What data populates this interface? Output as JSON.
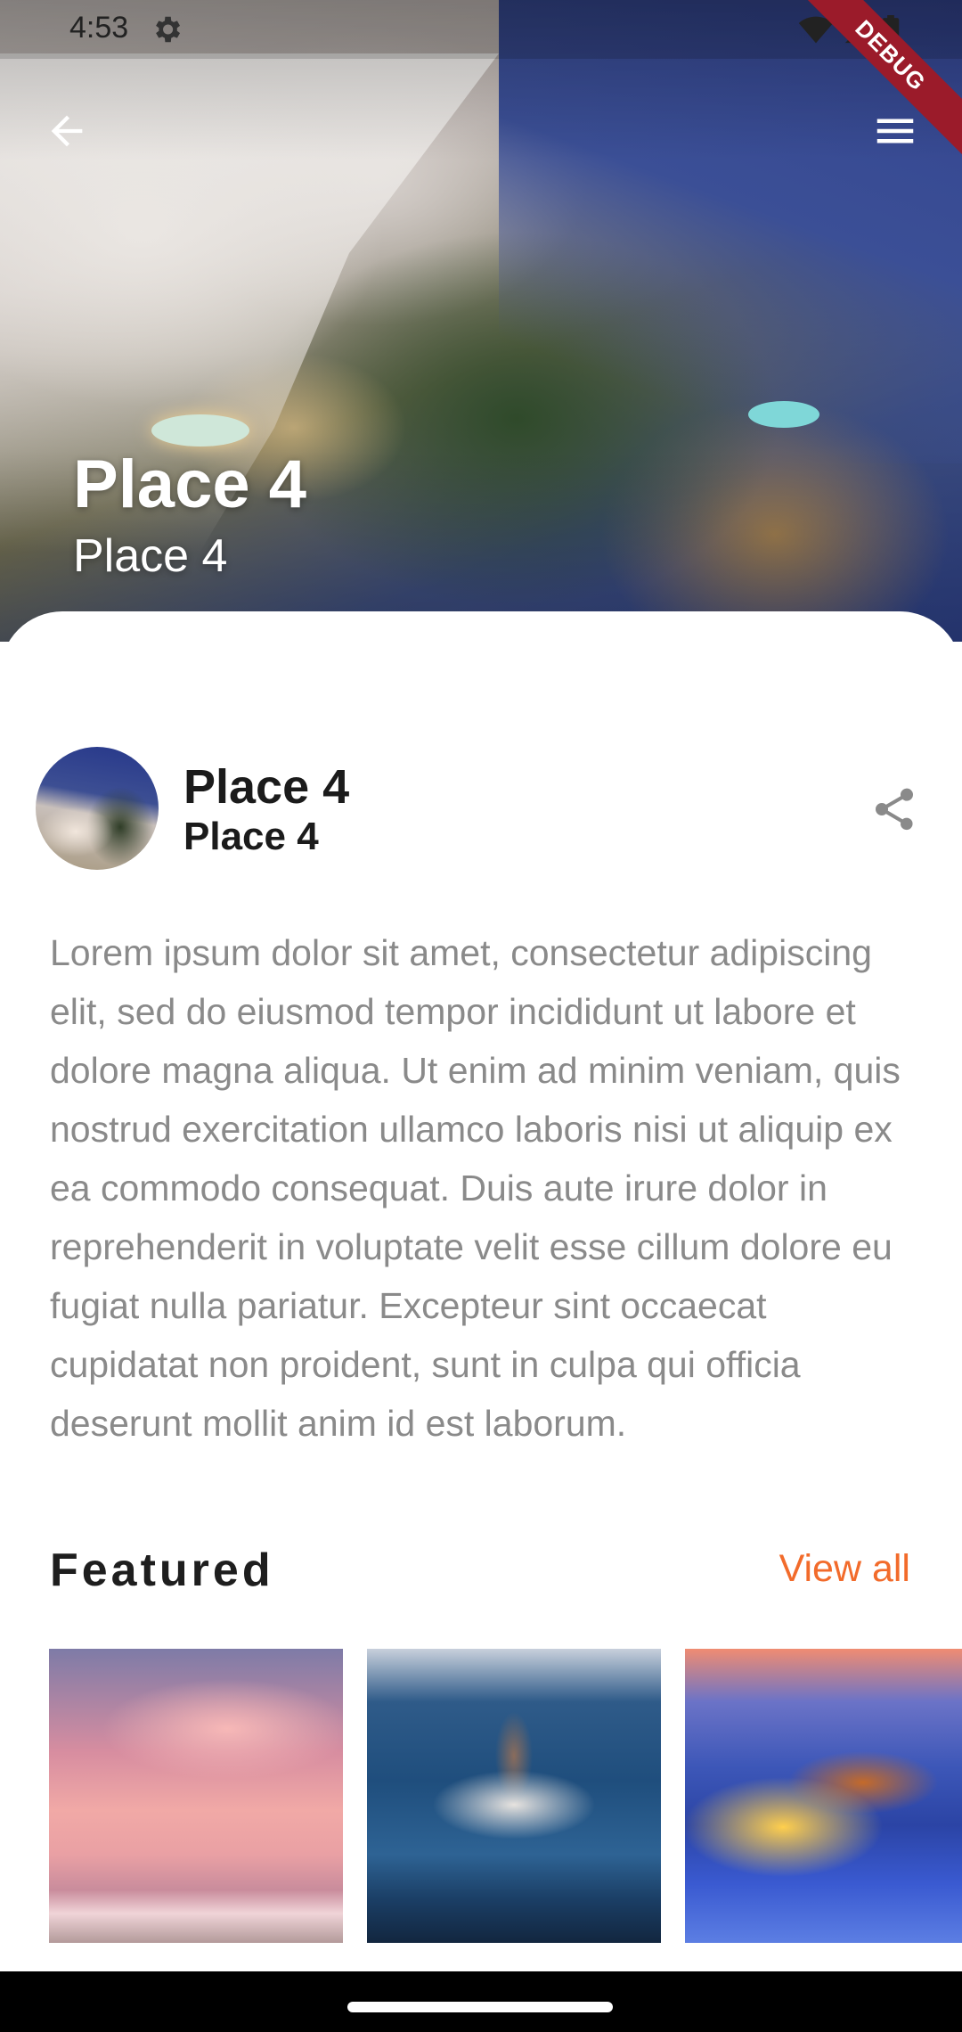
{
  "status_bar": {
    "time": "4:53",
    "icons": [
      "gear-icon",
      "wifi-icon",
      "signal-icon",
      "battery-icon"
    ]
  },
  "debug_banner": "DEBUG",
  "hero": {
    "title": "Place 4",
    "subtitle": "Place 4"
  },
  "profile": {
    "name": "Place 4",
    "subtitle": "Place 4"
  },
  "description": "Lorem ipsum dolor sit amet, consectetur adipiscing elit, sed do eiusmod tempor incididunt ut labore et dolore magna aliqua. Ut enim ad minim veniam, quis nostrud exercitation ullamco laboris nisi ut aliquip ex ea commodo consequat. Duis aute irure dolor in reprehenderit in voluptate velit esse cillum dolore eu fugiat nulla pariatur. Excepteur sint occaecat cupidatat non proident, sunt in culpa qui officia deserunt mollit anim id est laborum.",
  "featured": {
    "heading": "Featured",
    "view_all": "View all"
  },
  "colors": {
    "accent": "#f26b2b",
    "debug_ribbon": "#9b1b2a",
    "description_text": "#8a8a8a"
  }
}
